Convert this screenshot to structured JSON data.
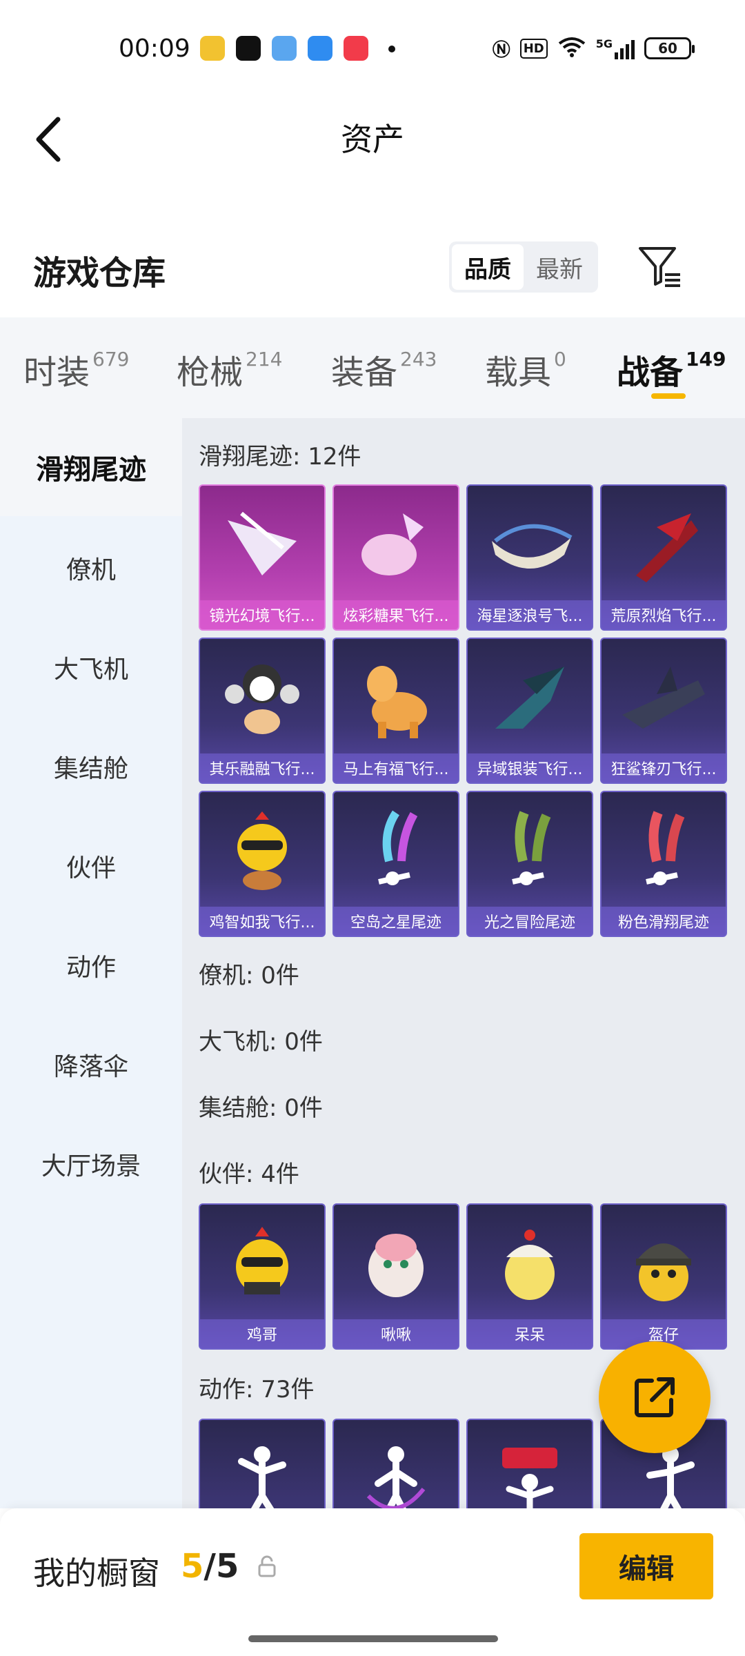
{
  "status_bar": {
    "time": "00:09",
    "battery": "60",
    "network": "5G",
    "hd": "HD"
  },
  "nav": {
    "title": "资产"
  },
  "warehouse": {
    "title": "游戏仓库",
    "sort_options": [
      "品质",
      "最新"
    ],
    "active_sort": "品质"
  },
  "tabs": [
    {
      "label": "时装",
      "count": "679"
    },
    {
      "label": "枪械",
      "count": "214"
    },
    {
      "label": "装备",
      "count": "243"
    },
    {
      "label": "载具",
      "count": "0"
    },
    {
      "label": "战备",
      "count": "149"
    }
  ],
  "active_tab": "战备",
  "sidebar": {
    "items": [
      "滑翔尾迹",
      "僚机",
      "大飞机",
      "集结舱",
      "伙伴",
      "动作",
      "降落伞",
      "大厅场景"
    ],
    "active": "滑翔尾迹"
  },
  "sections": {
    "glide": {
      "title": "滑翔尾迹: 12件",
      "items": [
        "镜光幻境飞行...",
        "炫彩糖果飞行...",
        "海星逐浪号飞...",
        "荒原烈焰飞行...",
        "其乐融融飞行...",
        "马上有福飞行...",
        "异域银装飞行...",
        "狂鲨锋刃飞行...",
        "鸡智如我飞行...",
        "空岛之星尾迹",
        "光之冒险尾迹",
        "粉色滑翔尾迹"
      ]
    },
    "wingman": {
      "title": "僚机: 0件"
    },
    "big_plane": {
      "title": "大飞机: 0件"
    },
    "pod": {
      "title": "集结舱: 0件"
    },
    "partner": {
      "title": "伙伴: 4件",
      "items": [
        "鸡哥",
        "啾啾",
        "呆呆",
        "盔仔"
      ]
    },
    "emote": {
      "title": "动作: 73件"
    }
  },
  "showcase": {
    "label": "我的橱窗",
    "current": "5",
    "separator": "/",
    "total": "5",
    "edit_label": "编辑"
  },
  "colors": {
    "accent": "#f8b400",
    "card_purple": "#3c3573",
    "card_pink": "#b23fae"
  }
}
